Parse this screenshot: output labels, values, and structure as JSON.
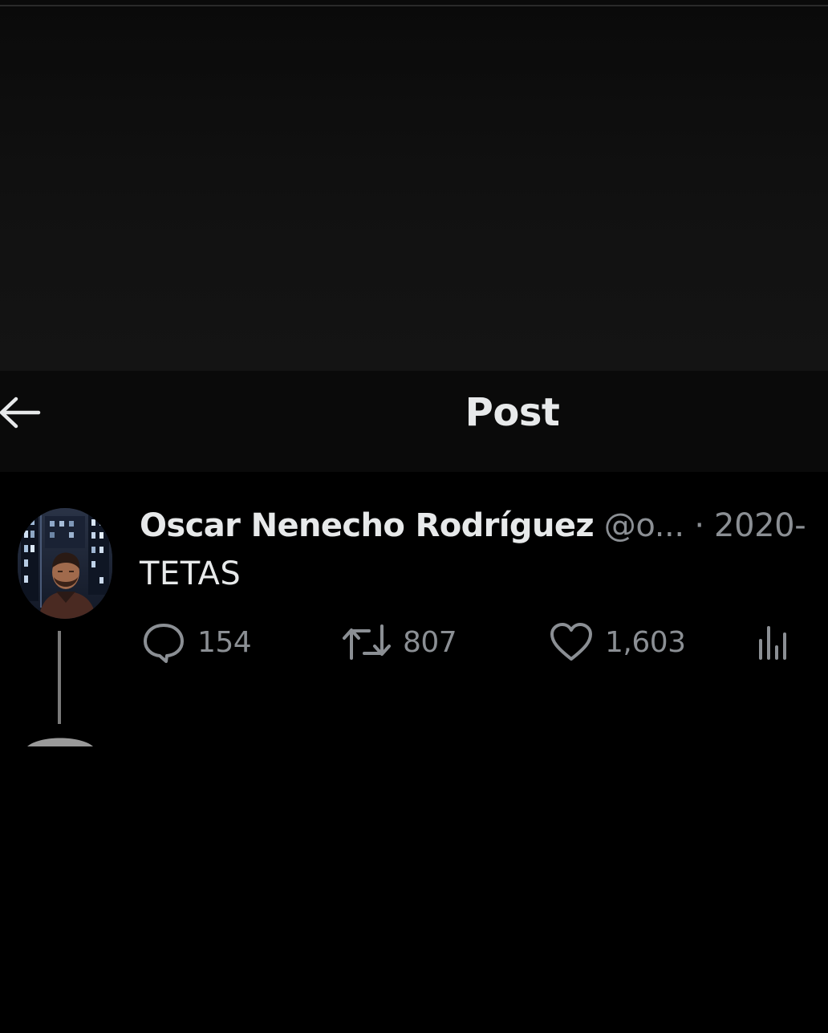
{
  "header": {
    "title": "Post",
    "back_icon": "arrow-left-icon"
  },
  "tweet": {
    "author_name": "Oscar Nenecho Rodríguez",
    "author_handle": "@o...",
    "date": "· 2020-",
    "text": "TETAS",
    "avatar_icon": "profile-photo"
  },
  "actions": {
    "replies": {
      "icon": "comment-icon",
      "count": "154"
    },
    "retweets": {
      "icon": "retweet-icon",
      "count": "807"
    },
    "likes": {
      "icon": "heart-icon",
      "count": "1,603"
    },
    "views": {
      "icon": "analytics-icon"
    }
  },
  "colors": {
    "background": "#000000",
    "header_bg": "#0a0a0a",
    "primary_text": "#e7e9ea",
    "secondary_text": "#8b8f94"
  }
}
